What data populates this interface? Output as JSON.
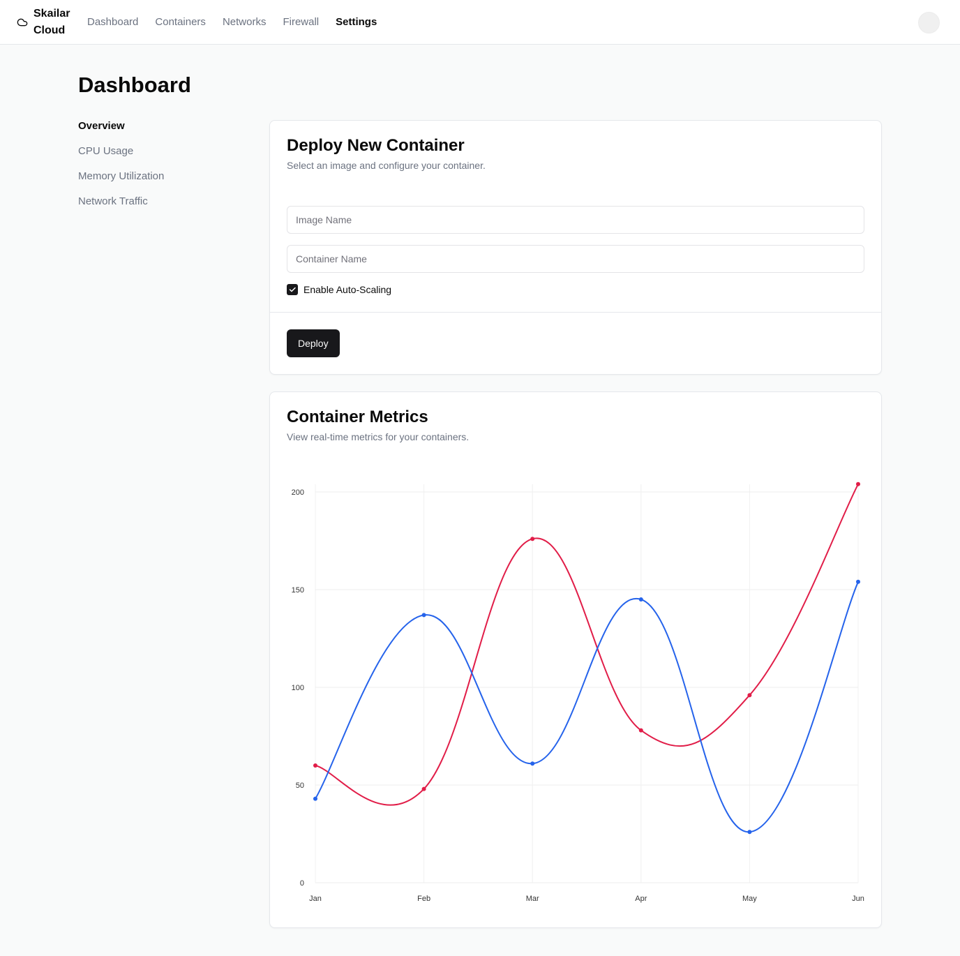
{
  "header": {
    "brand": "Skailar Cloud",
    "nav": [
      "Dashboard",
      "Containers",
      "Networks",
      "Firewall",
      "Settings"
    ],
    "active_nav": "Settings"
  },
  "page": {
    "title": "Dashboard"
  },
  "sidebar": {
    "items": [
      "Overview",
      "CPU Usage",
      "Memory Utilization",
      "Network Traffic"
    ],
    "active": "Overview"
  },
  "deploy": {
    "title": "Deploy New Container",
    "description": "Select an image and configure your container.",
    "image_placeholder": "Image Name",
    "container_placeholder": "Container Name",
    "autoscale_label": "Enable Auto-Scaling",
    "autoscale_checked": true,
    "deploy_label": "Deploy"
  },
  "metrics": {
    "title": "Container Metrics",
    "description": "View real-time metrics for your containers."
  },
  "colors": {
    "series_red": "#e11d48",
    "series_blue": "#2563eb",
    "primary": "#18181b"
  },
  "chart_data": {
    "type": "line",
    "categories": [
      "Jan",
      "Feb",
      "Mar",
      "Apr",
      "May",
      "Jun"
    ],
    "series": [
      {
        "values": [
          60,
          48,
          176,
          78,
          96,
          204
        ],
        "color": "#e11d48"
      },
      {
        "values": [
          43,
          137,
          61,
          145,
          26,
          154
        ],
        "color": "#2563eb"
      }
    ],
    "yticks": [
      0,
      50,
      100,
      150,
      200
    ],
    "ylim": [
      0,
      200
    ],
    "grid": true,
    "curve": "smooth"
  }
}
